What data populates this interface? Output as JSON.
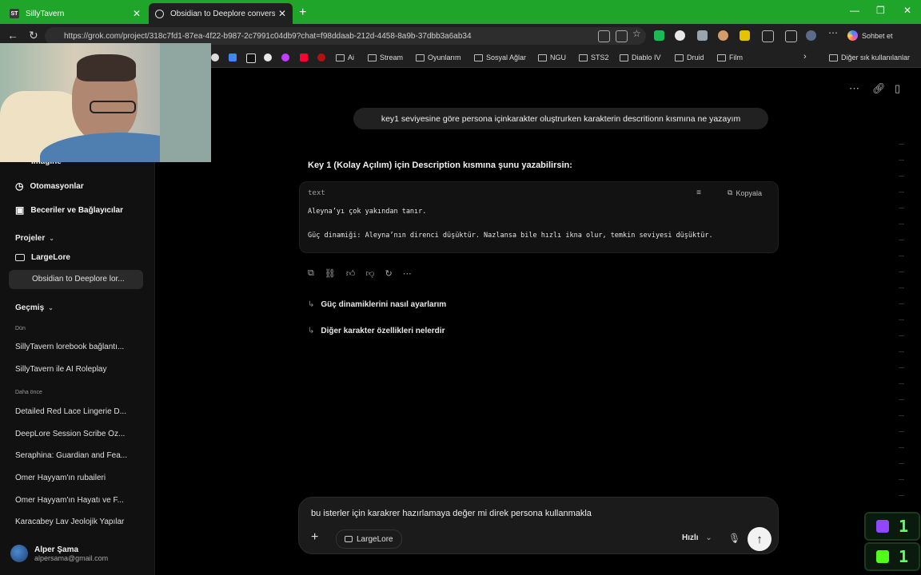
{
  "browser": {
    "tabs": [
      {
        "label": "SillyTavern",
        "favicon": "ST"
      },
      {
        "label": "Obsidian to Deeplore conversi",
        "favicon": "grok"
      }
    ],
    "url": "https://grok.com/project/318c7fd1-87ea-4f22-b987-2c7991c04db9?chat=f98ddaab-212d-4458-8a9b-37dbb3a6ab34",
    "sohbet_label": "Sohbet et",
    "bookmarks": [
      "Ai",
      "Stream",
      "Oyunlarım",
      "Sosyal Ağlar",
      "NGU",
      "STS2",
      "Diablo IV",
      "Druid",
      "Film"
    ],
    "other_bookmarks": "Diğer sık kullanılanlar"
  },
  "sidebar": {
    "partial_item": "Imagine",
    "items": [
      {
        "label": "Otomasyonlar",
        "icon": "automation-icon"
      },
      {
        "label": "Beceriler ve Bağlayıcılar",
        "icon": "skills-icon"
      }
    ],
    "projects_label": "Projeler",
    "project": "LargeLore",
    "active_chat": "Obsidian to Deeplore lor...",
    "history_label": "Geçmiş",
    "yesterday_label": "Dün",
    "yesterday_chats": [
      "SillyTavern lorebook bağlantı...",
      "SillyTavern ile AI Roleplay"
    ],
    "earlier_label": "Daha önce",
    "earlier_chats": [
      "Detailed Red Lace Lingerie D...",
      "DeepLore Session Scribe Öz...",
      "Seraphina: Guardian and Fea...",
      "Ömer Hayyam'ın rubaileri",
      "Ömer Hayyam'ın Hayatı ve F...",
      "Karacabey Lav Jeolojik Yapılar"
    ],
    "user": {
      "name": "Alper Şama",
      "email": "alpersama@gmail.com"
    }
  },
  "chat": {
    "user_message": "key1 seviyesine göre persona içinkarakter oluştrurken karakterin descritionn kısmına ne yazayım",
    "answer_intro": "Key 1 (Kolay Açılım) için Description kısmına şunu yazabilirsin:",
    "code": {
      "lang": "text",
      "copy_label": "Kopyala",
      "lines": [
        "Aleyna’yı çok yakından tanır.",
        "",
        "Güç dinamiği: Aleyna’nın direnci düşüktür. Nazlansa bile hızlı ikna olur, temkin seviyesi düşüktür."
      ]
    },
    "followups": [
      "Güç dinamiklerini nasıl ayarlarım",
      "Diğer karakter özellikleri nelerdir"
    ]
  },
  "composer": {
    "text": "bu isterler için karakrer hazırlamaya değer mi  direk persona kullanmakla",
    "project_chip": "LargeLore",
    "mode": "Hızlı"
  },
  "overlay_badges": [
    {
      "icon": "twitch-icon",
      "count": "1",
      "color": "#9146ff"
    },
    {
      "icon": "kick-icon",
      "count": "1",
      "color": "#53fc18"
    }
  ]
}
